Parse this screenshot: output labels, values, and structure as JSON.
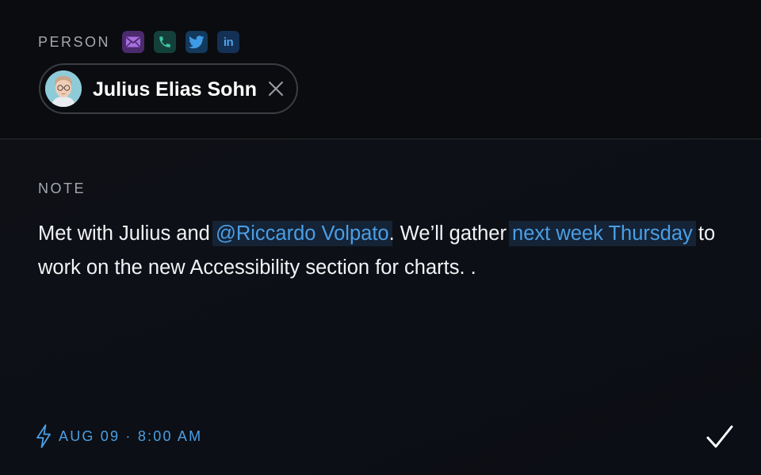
{
  "person": {
    "section_label": "PERSON",
    "contact_icons": [
      "mail-icon",
      "phone-icon",
      "twitter-icon",
      "linkedin-icon"
    ],
    "linkedin_glyph": "in",
    "selected": {
      "name": "Julius Elias Sohn"
    }
  },
  "note": {
    "section_label": "NOTE",
    "segments": [
      {
        "text": "Met with Julius and ",
        "highlight": false
      },
      {
        "text": "@Riccardo Volpato",
        "highlight": true
      },
      {
        "text": ". We’ll gather ",
        "highlight": false
      },
      {
        "text": "next week Thursday",
        "highlight": true
      },
      {
        "text": " to work on the new Accessibility section for charts. .",
        "highlight": false
      }
    ]
  },
  "footer": {
    "timestamp": "AUG 09 · 8:00 AM"
  },
  "colors": {
    "accent": "#4a9fe6",
    "highlight_bg": "#152336",
    "mail_bg": "#4b2a6e",
    "phone_bg": "#14403c",
    "twitter_bg": "#13395c",
    "linkedin_bg": "#143055"
  }
}
